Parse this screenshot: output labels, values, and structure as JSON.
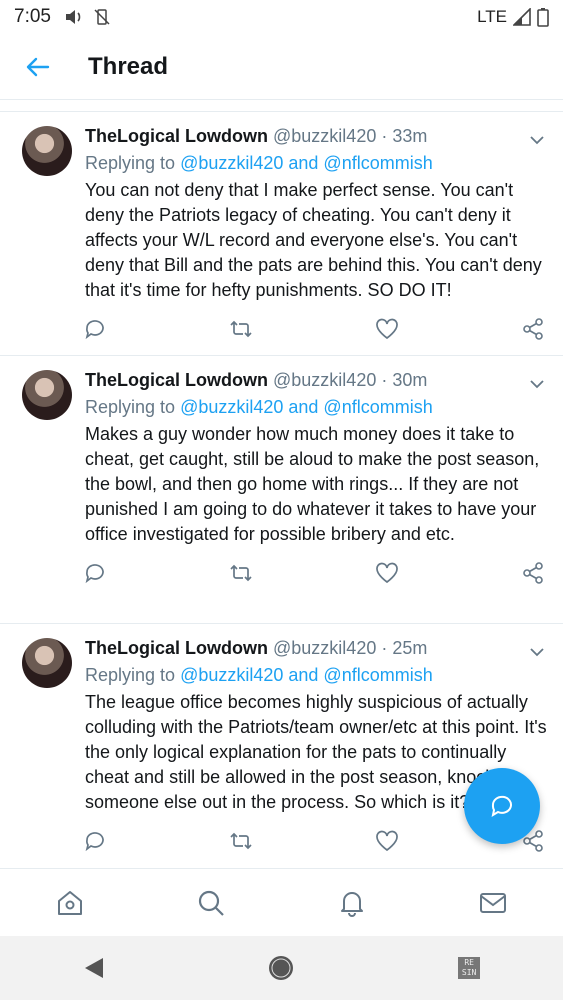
{
  "status_bar": {
    "time": "7:05",
    "network": "LTE"
  },
  "header": {
    "title": "Thread"
  },
  "tweets": [
    {
      "name": "TheLogical Lowdown",
      "handle": "@buzzkil420",
      "time": "· 33m",
      "replying_prefix": "Replying to",
      "replying_to": "@buzzkil420 and @nflcommish",
      "text": "You can not deny that I make perfect sense. You can't deny the Patriots legacy of cheating. You can't deny it affects your W/L record and everyone else's. You can't deny that Bill and the pats are behind this. You can't deny that it's time for hefty punishments. SO DO IT!"
    },
    {
      "name": "TheLogical Lowdown",
      "handle": "@buzzkil420",
      "time": "· 30m",
      "replying_prefix": "Replying to",
      "replying_to": "@buzzkil420 and @nflcommish",
      "text": "Makes a guy wonder how much money does it take to cheat, get caught, still be aloud to make the post season, the bowl, and then go home with rings...  If they are not punished I am going to do whatever it takes to have your office investigated for possible bribery and etc."
    },
    {
      "name": "TheLogical Lowdown",
      "handle": "@buzzkil420",
      "time": "· 25m",
      "replying_prefix": "Replying to",
      "replying_to": "@buzzkil420 and @nflcommish",
      "text": "The league office becomes highly suspicious of actually colluding with the Patriots/team owner/etc at this point. It's the only logical explanation for the pats to continually cheat and still be allowed in the post season, knocking someone else out in the process. So which is it?"
    }
  ],
  "system_nav": {
    "recents_label": "RE SIN"
  },
  "colors": {
    "accent": "#1da1f2",
    "secondary_text": "#657786",
    "divider": "#e6ecf0"
  },
  "icons": {
    "back": "arrow-left-icon",
    "caret": "chevron-down-icon",
    "reply": "comment-icon",
    "retweet": "retweet-icon",
    "like": "heart-icon",
    "share": "share-icon",
    "compose": "compose-reply-icon",
    "home": "home-icon",
    "search": "search-icon",
    "notifications": "bell-icon",
    "messages": "mail-icon"
  }
}
